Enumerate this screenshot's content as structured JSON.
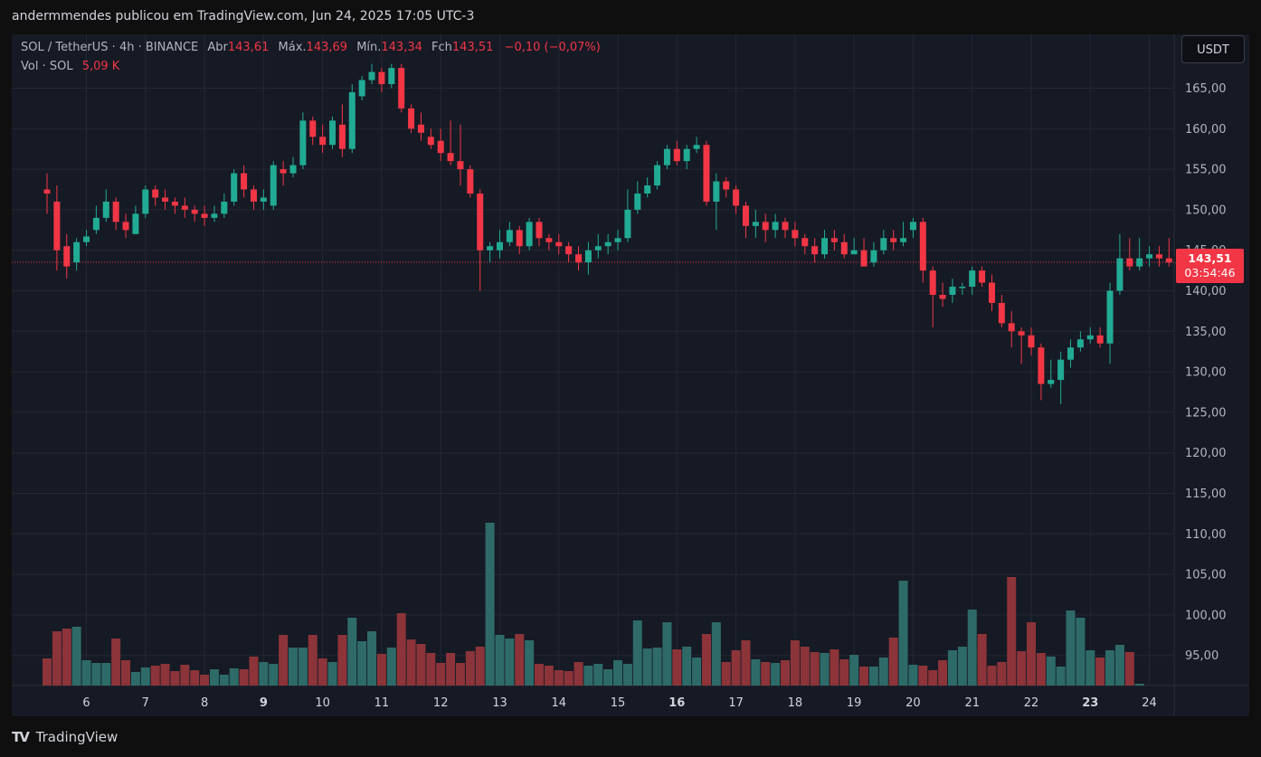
{
  "header": {
    "published": "andermmendes publicou em TradingView.com, Jun 24, 2025 17:05 UTC-3"
  },
  "legend": {
    "symbol": "SOL / TetherUS · 4h · BINANCE",
    "open_label": "Abr",
    "open": "143,61",
    "high_label": "Máx.",
    "high": "143,69",
    "low_label": "Mín.",
    "low": "143,34",
    "close_label": "Fch",
    "close": "143,51",
    "change": "−0,10 (−0,07%)",
    "vol_label": "Vol · SOL",
    "vol": "5,09 K"
  },
  "currency_button": "USDT",
  "last_price": {
    "price": "143,51",
    "countdown": "03:54:46"
  },
  "footer": {
    "logo": "TradingView"
  },
  "colors": {
    "up": "#22ab94",
    "down": "#f23645",
    "up_vol": "#2e6b68",
    "down_vol": "#8c3439",
    "background": "#161a25"
  },
  "chart_data": {
    "type": "candlestick",
    "timeframe": "4h",
    "y_ticks": [
      "165,00",
      "160,00",
      "155,00",
      "150,00",
      "145,00",
      "140,00",
      "135,00",
      "130,00",
      "125,00",
      "120,00",
      "115,00",
      "110,00",
      "105,00",
      "100,00",
      "95,00"
    ],
    "x_ticks": [
      {
        "label": "6",
        "bold": false,
        "index": 4
      },
      {
        "label": "7",
        "bold": false,
        "index": 10
      },
      {
        "label": "8",
        "bold": false,
        "index": 16
      },
      {
        "label": "9",
        "bold": true,
        "index": 22
      },
      {
        "label": "10",
        "bold": false,
        "index": 28
      },
      {
        "label": "11",
        "bold": false,
        "index": 34
      },
      {
        "label": "12",
        "bold": false,
        "index": 40
      },
      {
        "label": "13",
        "bold": false,
        "index": 46
      },
      {
        "label": "14",
        "bold": false,
        "index": 52
      },
      {
        "label": "15",
        "bold": false,
        "index": 58
      },
      {
        "label": "16",
        "bold": true,
        "index": 64
      },
      {
        "label": "17",
        "bold": false,
        "index": 70
      },
      {
        "label": "18",
        "bold": false,
        "index": 76
      },
      {
        "label": "19",
        "bold": false,
        "index": 82
      },
      {
        "label": "20",
        "bold": false,
        "index": 88
      },
      {
        "label": "21",
        "bold": false,
        "index": 94
      },
      {
        "label": "22",
        "bold": false,
        "index": 100
      },
      {
        "label": "23",
        "bold": true,
        "index": 106
      },
      {
        "label": "24",
        "bold": false,
        "index": 112
      }
    ],
    "candles": [
      [
        152.5,
        152.0,
        154.5,
        149.5
      ],
      [
        151.0,
        145.0,
        153.0,
        142.5
      ],
      [
        145.5,
        143.0,
        147.0,
        141.5
      ],
      [
        143.5,
        146.0,
        146.5,
        142.5
      ],
      [
        146.0,
        146.7,
        147.5,
        145.5
      ],
      [
        147.5,
        149.0,
        150.5,
        147.0
      ],
      [
        149.0,
        151.0,
        152.5,
        148.5
      ],
      [
        151.0,
        148.5,
        151.5,
        147.5
      ],
      [
        148.5,
        147.5,
        149.5,
        146.5
      ],
      [
        147.0,
        149.5,
        150.5,
        147.0
      ],
      [
        149.5,
        152.5,
        153.0,
        149.0
      ],
      [
        152.5,
        151.5,
        153.0,
        150.5
      ],
      [
        151.5,
        151.0,
        152.5,
        150.0
      ],
      [
        151.0,
        150.5,
        151.5,
        149.5
      ],
      [
        150.5,
        150.0,
        151.5,
        149.0
      ],
      [
        150.0,
        149.5,
        150.5,
        148.5
      ],
      [
        149.5,
        149.0,
        150.5,
        148.0
      ],
      [
        149.0,
        149.5,
        150.5,
        148.5
      ],
      [
        149.5,
        151.0,
        152.0,
        149.0
      ],
      [
        151.0,
        154.5,
        155.0,
        150.5
      ],
      [
        154.5,
        152.5,
        155.5,
        151.5
      ],
      [
        152.5,
        151.0,
        153.0,
        150.0
      ],
      [
        151.0,
        151.5,
        152.5,
        150.0
      ],
      [
        150.5,
        155.5,
        156.0,
        150.0
      ],
      [
        155.0,
        154.5,
        156.0,
        153.0
      ],
      [
        154.5,
        155.5,
        156.5,
        154.0
      ],
      [
        155.5,
        161.0,
        162.0,
        155.0
      ],
      [
        161.0,
        159.0,
        161.5,
        158.0
      ],
      [
        159.0,
        158.0,
        160.5,
        157.0
      ],
      [
        158.0,
        161.0,
        161.5,
        157.5
      ],
      [
        160.5,
        157.5,
        163.0,
        156.5
      ],
      [
        157.5,
        164.5,
        165.5,
        157.0
      ],
      [
        164.0,
        166.0,
        166.5,
        163.5
      ],
      [
        166.0,
        167.0,
        168.0,
        165.5
      ],
      [
        167.0,
        165.5,
        167.5,
        164.5
      ],
      [
        165.5,
        167.5,
        168.0,
        165.0
      ],
      [
        167.5,
        162.5,
        168.0,
        162.0
      ],
      [
        162.5,
        160.0,
        163.0,
        159.5
      ],
      [
        160.5,
        159.5,
        162.0,
        158.5
      ],
      [
        159.0,
        158.0,
        160.0,
        157.5
      ],
      [
        158.5,
        157.0,
        160.0,
        156.0
      ],
      [
        157.0,
        156.0,
        161.0,
        155.5
      ],
      [
        156.0,
        155.0,
        160.5,
        153.0
      ],
      [
        155.0,
        152.0,
        155.5,
        151.5
      ],
      [
        152.0,
        145.0,
        152.5,
        140.0
      ],
      [
        145.0,
        145.5,
        146.0,
        143.5
      ],
      [
        145.0,
        146.0,
        147.5,
        144.0
      ],
      [
        146.0,
        147.5,
        148.5,
        145.5
      ],
      [
        147.5,
        145.5,
        148.0,
        144.5
      ],
      [
        145.5,
        148.5,
        149.0,
        145.0
      ],
      [
        148.5,
        146.5,
        149.0,
        145.5
      ],
      [
        146.5,
        146.0,
        147.0,
        145.0
      ],
      [
        146.0,
        145.5,
        147.0,
        144.5
      ],
      [
        145.5,
        144.5,
        146.0,
        143.5
      ],
      [
        144.5,
        143.5,
        145.5,
        142.5
      ],
      [
        143.5,
        145.0,
        146.0,
        142.0
      ],
      [
        145.0,
        145.5,
        147.0,
        144.0
      ],
      [
        145.5,
        146.0,
        147.0,
        144.5
      ],
      [
        146.0,
        146.5,
        147.5,
        145.0
      ],
      [
        146.5,
        150.0,
        152.5,
        146.0
      ],
      [
        150.0,
        152.0,
        153.5,
        149.5
      ],
      [
        152.0,
        153.0,
        154.0,
        151.5
      ],
      [
        153.0,
        155.5,
        156.0,
        152.5
      ],
      [
        155.5,
        157.5,
        158.0,
        155.0
      ],
      [
        157.5,
        156.0,
        158.5,
        155.5
      ],
      [
        156.0,
        157.5,
        158.0,
        155.0
      ],
      [
        157.5,
        158.0,
        159.0,
        157.0
      ],
      [
        158.0,
        151.0,
        158.5,
        150.5
      ],
      [
        151.0,
        153.5,
        154.5,
        147.5
      ],
      [
        153.5,
        152.5,
        154.0,
        151.5
      ],
      [
        152.5,
        150.5,
        153.0,
        149.5
      ],
      [
        150.5,
        148.0,
        151.0,
        146.5
      ],
      [
        148.0,
        148.5,
        150.0,
        146.5
      ],
      [
        148.5,
        147.5,
        149.5,
        146.0
      ],
      [
        147.5,
        148.5,
        149.5,
        146.5
      ],
      [
        148.5,
        147.5,
        149.0,
        146.5
      ],
      [
        147.5,
        146.5,
        148.5,
        145.5
      ],
      [
        146.5,
        145.5,
        147.0,
        144.5
      ],
      [
        145.5,
        144.5,
        146.5,
        143.5
      ],
      [
        144.5,
        146.5,
        147.5,
        144.0
      ],
      [
        146.5,
        146.0,
        147.5,
        145.0
      ],
      [
        146.0,
        144.5,
        147.0,
        144.0
      ],
      [
        144.5,
        145.0,
        146.5,
        144.5
      ],
      [
        145.0,
        143.0,
        146.5,
        143.0
      ],
      [
        143.5,
        145.0,
        146.0,
        143.0
      ],
      [
        145.0,
        146.5,
        147.5,
        144.5
      ],
      [
        146.5,
        146.0,
        147.5,
        145.0
      ],
      [
        146.0,
        146.5,
        148.5,
        145.5
      ],
      [
        147.5,
        148.5,
        149.0,
        146.5
      ],
      [
        148.5,
        142.5,
        149.0,
        141.0
      ],
      [
        142.5,
        139.5,
        143.0,
        135.5
      ],
      [
        139.5,
        139.0,
        141.0,
        138.0
      ],
      [
        139.5,
        140.5,
        141.5,
        138.5
      ],
      [
        140.5,
        140.5,
        141.0,
        139.5
      ],
      [
        140.5,
        142.5,
        143.0,
        139.5
      ],
      [
        142.5,
        141.0,
        143.0,
        140.5
      ],
      [
        141.0,
        138.5,
        142.0,
        137.5
      ],
      [
        138.5,
        136.0,
        139.5,
        135.5
      ],
      [
        136.0,
        135.0,
        137.5,
        133.0
      ],
      [
        135.0,
        134.5,
        135.5,
        131.0
      ],
      [
        134.5,
        133.0,
        135.5,
        132.0
      ],
      [
        133.0,
        128.5,
        133.5,
        126.5
      ],
      [
        128.5,
        129.0,
        131.5,
        128.0
      ],
      [
        129.0,
        131.5,
        132.5,
        126.0
      ],
      [
        131.5,
        133.0,
        134.0,
        130.5
      ],
      [
        133.0,
        134.0,
        135.0,
        132.5
      ],
      [
        134.0,
        134.5,
        135.5,
        133.5
      ],
      [
        134.5,
        133.5,
        135.5,
        133.0
      ],
      [
        133.5,
        140.0,
        141.0,
        131.0
      ],
      [
        140.0,
        144.0,
        147.0,
        139.5
      ],
      [
        144.0,
        143.0,
        146.5,
        142.5
      ],
      [
        143.0,
        144.0,
        146.5,
        142.5
      ],
      [
        144.0,
        144.5,
        145.5,
        143.0
      ],
      [
        144.5,
        144.0,
        145.5,
        143.0
      ],
      [
        144.0,
        143.5,
        146.5,
        143.0
      ],
      [
        143.5,
        143.5,
        144.0,
        143.3
      ]
    ],
    "volume_heights": [
      30,
      60,
      63,
      65,
      28,
      25,
      25,
      52,
      28,
      15,
      20,
      22,
      24,
      16,
      23,
      17,
      12,
      18,
      12,
      19,
      18,
      32,
      26,
      24,
      56,
      42,
      42,
      56,
      30,
      26,
      56,
      75,
      49,
      60,
      35,
      42,
      80,
      51,
      46,
      36,
      25,
      36,
      25,
      38,
      43,
      180,
      56,
      52,
      57,
      50,
      24,
      22,
      17,
      16,
      26,
      22,
      24,
      18,
      28,
      24,
      72,
      41,
      42,
      70,
      40,
      43,
      31,
      57,
      70,
      26,
      39,
      50,
      29,
      26,
      25,
      28,
      50,
      43,
      37,
      36,
      40,
      29,
      34,
      21,
      21,
      31,
      53,
      116,
      23,
      22,
      17,
      28,
      39,
      43,
      84,
      57,
      22,
      26,
      120,
      38,
      70,
      36,
      32,
      21,
      83,
      75,
      39,
      31,
      39,
      45,
      37,
      2
    ]
  }
}
